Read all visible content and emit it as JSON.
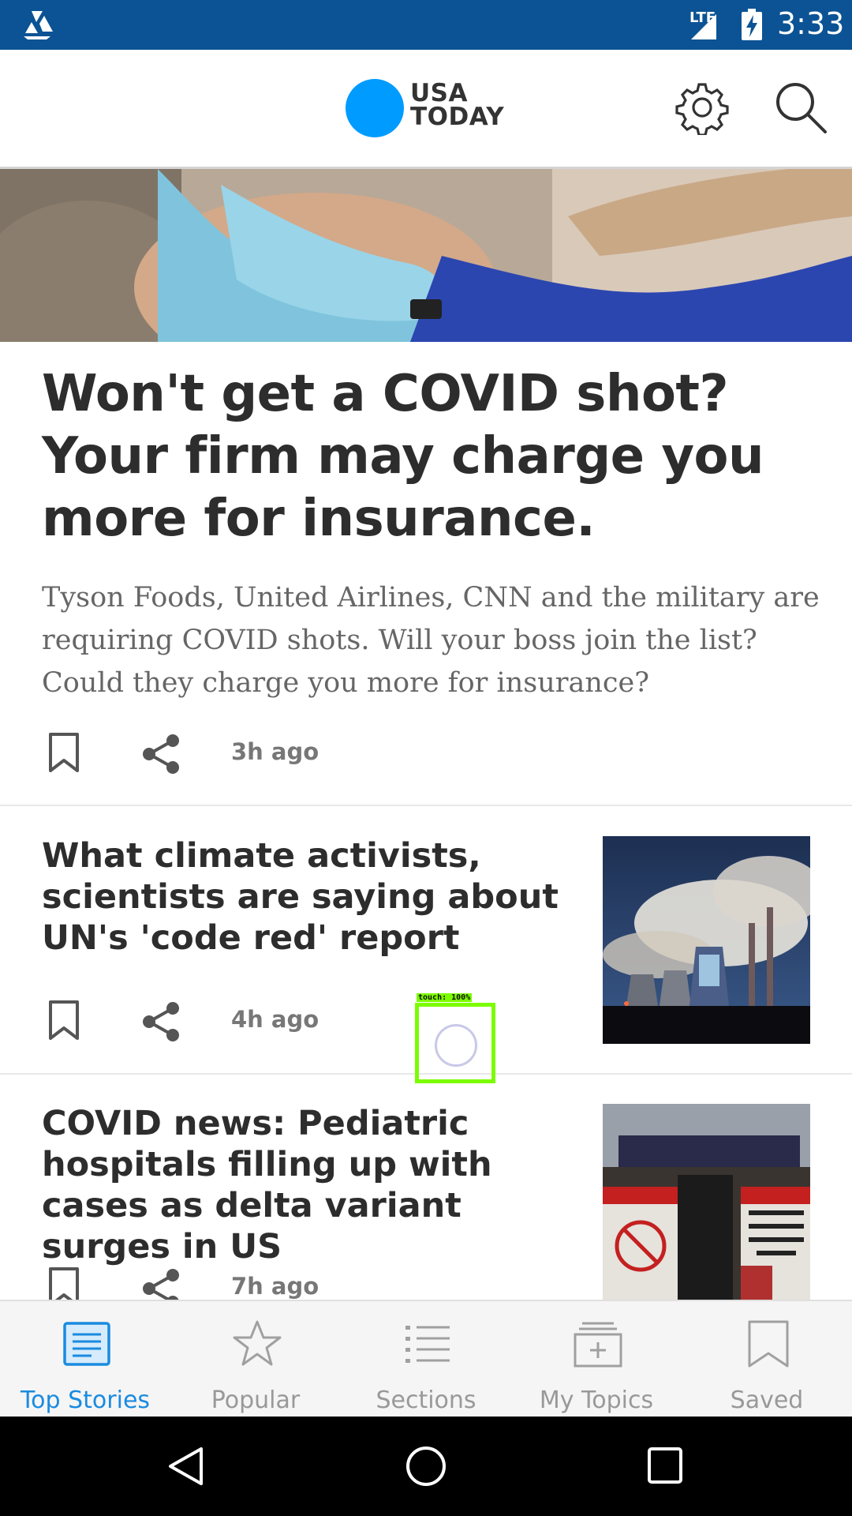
{
  "status_bar": {
    "network": "LTE",
    "time": "3:33",
    "icons": [
      "app-notification-icon",
      "signal-icon",
      "battery-charging-icon"
    ]
  },
  "header": {
    "logo_line1": "USA",
    "logo_line2": "TODAY",
    "logo_color": "#009bff",
    "icons": [
      "gear-icon",
      "search-icon"
    ]
  },
  "lead_story": {
    "title": "Won't get a COVID shot? Your firm may charge you more for insurance.",
    "summary": "Tyson Foods, United Airlines, CNN and the military are requiring COVID shots. Will your boss join the list? Could they charge you more for insurance?",
    "time": "3h ago"
  },
  "stories": [
    {
      "title": "What climate activists, scientists are saying about UN's 'code red' report",
      "time": "4h ago"
    },
    {
      "title": "COVID news: Pediatric hospitals filling up with cases as delta variant surges in US",
      "time": "7h ago"
    }
  ],
  "touch_indicator": {
    "label": "touch: 100%"
  },
  "bottom_nav": {
    "active_color": "#1a8be0",
    "items": [
      {
        "label": "Top Stories",
        "icon": "newspaper-icon"
      },
      {
        "label": "Popular",
        "icon": "star-icon"
      },
      {
        "label": "Sections",
        "icon": "list-icon"
      },
      {
        "label": "My Topics",
        "icon": "add-topic-icon"
      },
      {
        "label": "Saved",
        "icon": "bookmark-icon"
      }
    ]
  },
  "system_nav": {
    "icons": [
      "back-icon",
      "home-icon",
      "recents-icon"
    ]
  }
}
